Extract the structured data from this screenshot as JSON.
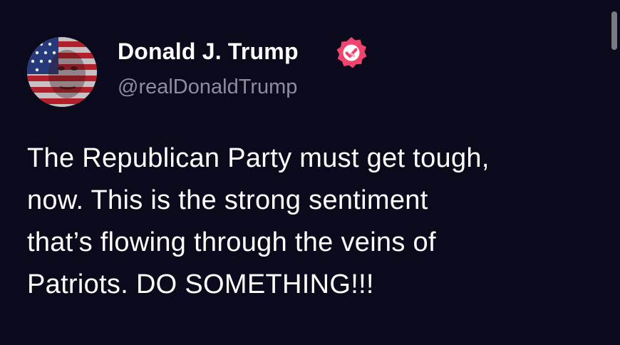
{
  "author": {
    "display_name": "Donald J. Trump",
    "handle": "@realDonaldTrump",
    "avatar_icon": "flag-portrait-avatar",
    "verified_icon": "verified-badge-icon"
  },
  "post": {
    "lines": [
      "The Republican Party must get tough,",
      "now. This is the strong sentiment",
      "that’s flowing through the veins of",
      "Patriots. DO SOMETHING!!!"
    ]
  },
  "colors": {
    "background": "#0b0a1c",
    "text": "#ffffff",
    "handle": "#8e8c9e",
    "badge": "#f0436e",
    "scrollbar": "#7a7a82"
  }
}
